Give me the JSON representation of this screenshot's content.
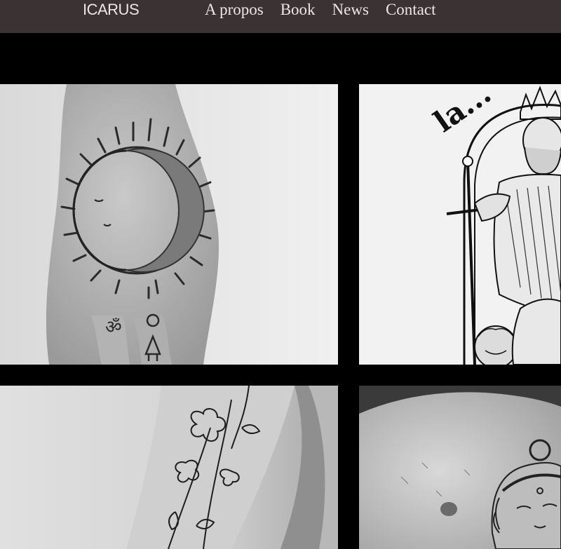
{
  "header": {
    "logo_text": "ICARUS",
    "nav": [
      {
        "label": "A propos"
      },
      {
        "label": "Book"
      },
      {
        "label": "News"
      },
      {
        "label": "Contact"
      }
    ]
  },
  "gallery": {
    "items": [
      {
        "description_icon": "moon-sun-hand-tattoo-photo"
      },
      {
        "description_icon": "king-tarot-card-illustration",
        "caption": "la..."
      },
      {
        "description_icon": "floral-arm-tattoo-photo"
      },
      {
        "description_icon": "chest-portrait-tattoo-photo"
      }
    ]
  },
  "colors": {
    "navbar_bg": "#3a3233",
    "nav_text": "#ece7e3",
    "page_bg": "#000000"
  }
}
